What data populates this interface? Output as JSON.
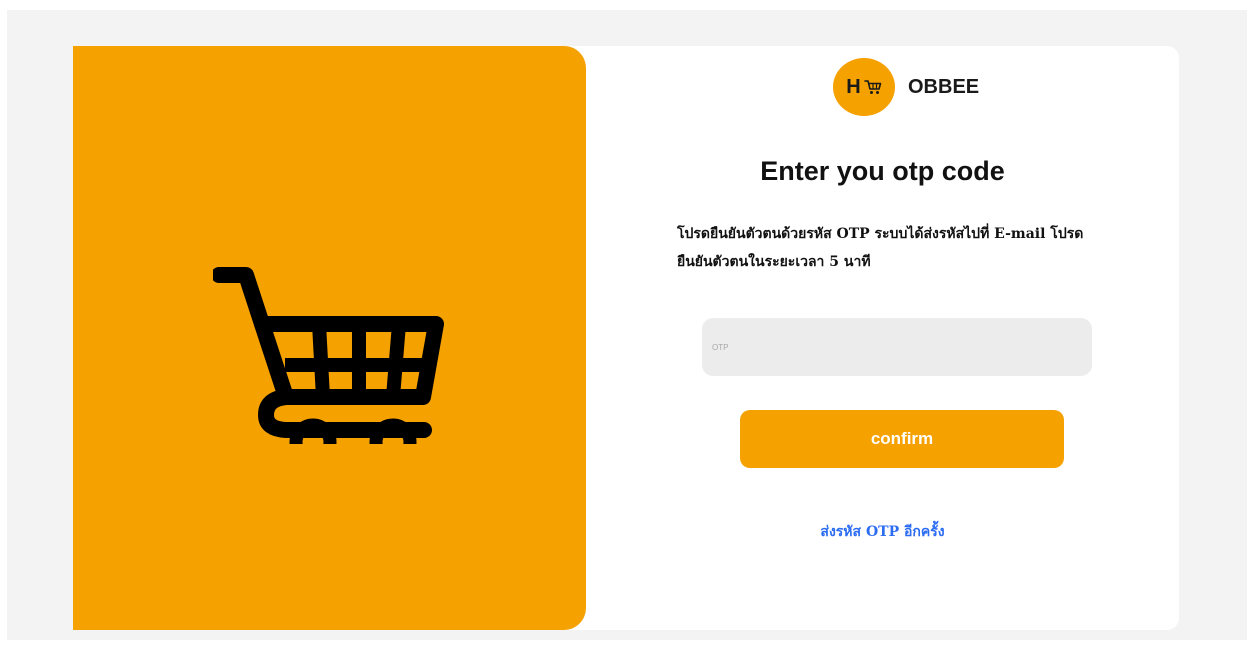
{
  "brand": {
    "logo_letter": "H",
    "name": "OBBEE",
    "accent_color": "#f5a100"
  },
  "otp": {
    "heading": "Enter you otp code",
    "description": "โปรดยืนยันตัวตนด้วยรหัส OTP ระบบได้ส่งรหัสไปที่ E-mail โปรดยืนยันตัวตนในระยะเวลา 5 นาที",
    "input": {
      "placeholder": "OTP",
      "value": ""
    },
    "confirm_label": "confirm",
    "resend_label": "ส่งรหัส OTP อีกครั้ง"
  },
  "icons": {
    "hero": "shopping-cart-icon",
    "logo": "shopping-cart-icon"
  },
  "colors": {
    "link": "#2b6cf2",
    "input_bg": "#ececec",
    "page_bg": "#f3f3f3"
  }
}
